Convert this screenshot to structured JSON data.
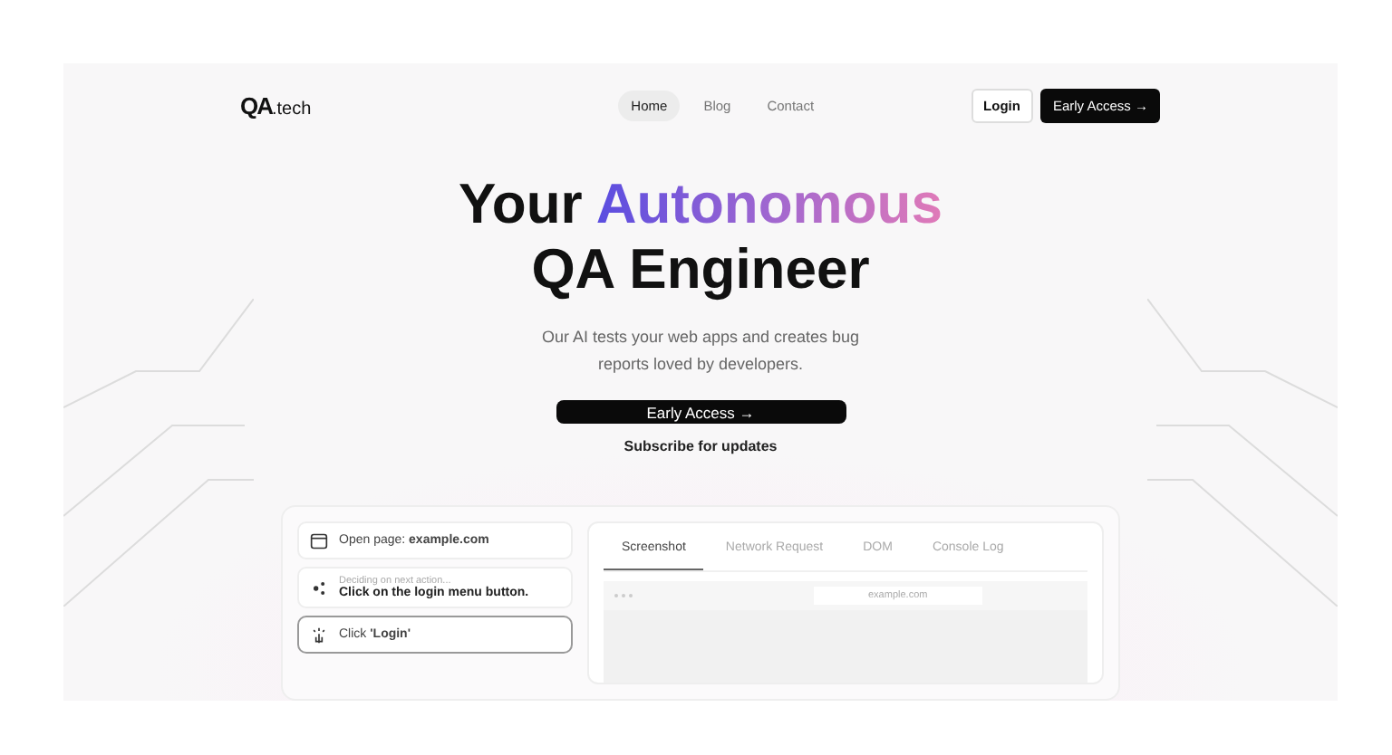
{
  "nav": {
    "logo_main": "QA",
    "logo_suffix": ".tech",
    "links": [
      {
        "label": "Home",
        "selected": true
      },
      {
        "label": "Blog",
        "selected": false
      },
      {
        "label": "Contact",
        "selected": false
      }
    ],
    "login": "Login",
    "cta": "Early Access",
    "cta_arrow": "→"
  },
  "hero": {
    "headline_lead": "Your",
    "headline_accent": "Autonomous",
    "headline_line2": "QA Engineer",
    "subtitle": "Our AI tests your web apps and creates bug reports loved by developers.",
    "cta": "Early Access",
    "cta_arrow": "→",
    "secondary": "Subscribe for updates"
  },
  "demo": {
    "steps": [
      {
        "kind": "browser",
        "text": "Open page: **example.com**",
        "selected": false
      },
      {
        "kind": "thinking",
        "caption": "Deciding on next action...",
        "text": "Click on the login menu button.",
        "selected": false
      },
      {
        "kind": "click",
        "text": "Click **'Login'**",
        "selected": true
      }
    ],
    "tabs": [
      {
        "label": "Screenshot",
        "selected": true
      },
      {
        "label": "Network Request",
        "selected": false
      },
      {
        "label": "DOM",
        "selected": false
      },
      {
        "label": "Console Log",
        "selected": false
      }
    ],
    "browser_url": "example.com"
  }
}
